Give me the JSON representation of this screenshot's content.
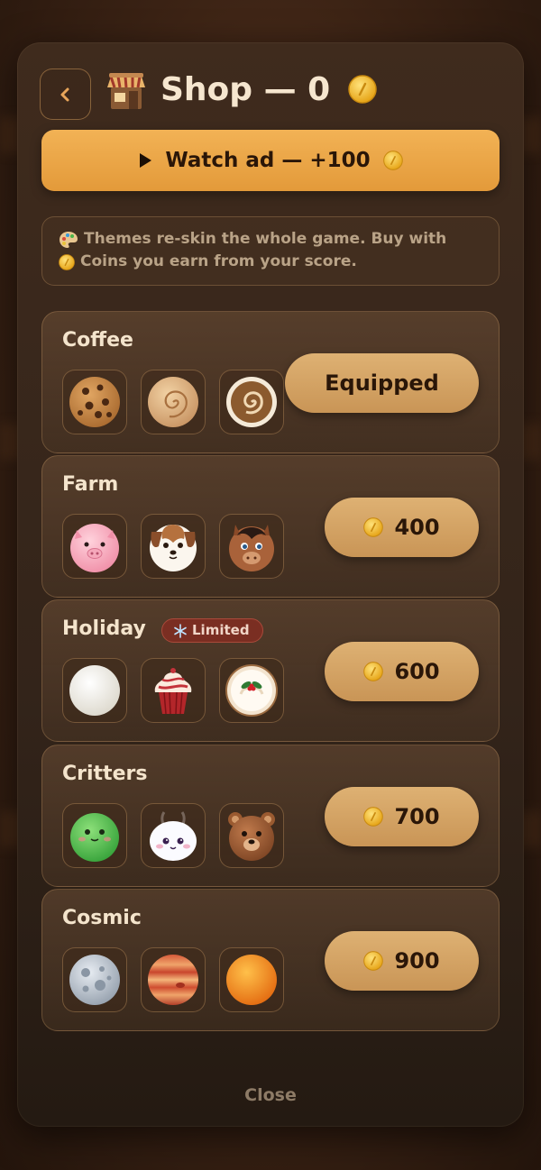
{
  "header": {
    "title": "Shop — 0",
    "back_icon": "chevron-left-icon",
    "shop_icon": "shop-stall-icon",
    "coin_icon": "coin-icon"
  },
  "watch_ad": {
    "label": "Watch ad — +100",
    "icon": "play-icon"
  },
  "info": {
    "line1": "Themes re-skin the whole game. Buy with",
    "line2": "Coins you earn from your score.",
    "palette_icon": "palette-icon"
  },
  "themes": [
    {
      "name": "Coffee",
      "action": "Equipped",
      "state": "equipped",
      "items": [
        "cookie-icon",
        "swirl-cream-icon",
        "latte-art-icon"
      ]
    },
    {
      "name": "Farm",
      "action": "400",
      "state": "buy",
      "items": [
        "pig-icon",
        "dog-icon",
        "horse-icon"
      ]
    },
    {
      "name": "Holiday",
      "badge": "Limited",
      "action": "600",
      "state": "buy",
      "items": [
        "snowball-icon",
        "cupcake-icon",
        "holly-cake-icon"
      ]
    },
    {
      "name": "Critters",
      "action": "700",
      "state": "buy",
      "items": [
        "frog-icon",
        "ghost-bunny-icon",
        "bear-icon"
      ]
    },
    {
      "name": "Cosmic",
      "action": "900",
      "state": "buy",
      "items": [
        "moon-icon",
        "jupiter-icon",
        "sun-icon"
      ]
    }
  ],
  "footer": {
    "close_label": "Close"
  },
  "colors": {
    "accent": "#e39a3a",
    "button": "#d4a263",
    "text_light": "#f4e4cc",
    "badge_bg": "#7a2e22"
  }
}
